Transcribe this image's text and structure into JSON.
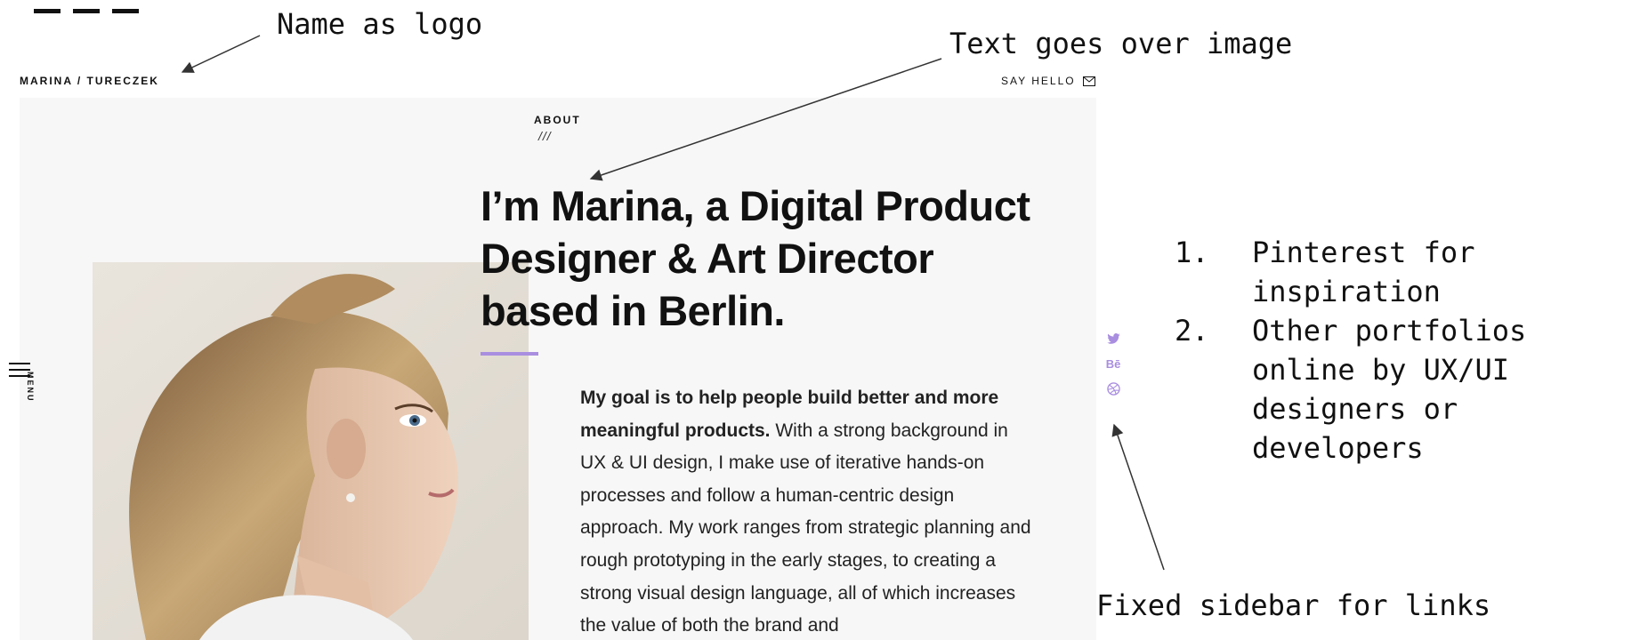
{
  "header": {
    "logo": "MARINA / TURECZEK",
    "say_hello": "SAY HELLO"
  },
  "section": {
    "label": "ABOUT",
    "divider": "///"
  },
  "headline": "I’m Marina, a Digital Product Designer & Art Director based in Berlin.",
  "body": {
    "lead": "My goal is to help people build better and more meaningful products.",
    "text": " With a strong background in UX & UI design, I make use of iterative hands-on processes and follow a human-centric design approach. My work ranges from strategic planning and rough prototyping in the early stages, to creating a strong visual design language, all of which increases the value of both the brand and"
  },
  "menu": {
    "label": "MENU"
  },
  "social": {
    "items": [
      {
        "icon": "twitter-icon"
      },
      {
        "icon": "behance-icon",
        "glyph": "Bē"
      },
      {
        "icon": "dribbble-icon"
      }
    ]
  },
  "annotations": {
    "logo_note": "Name as logo",
    "text_note": "Text goes over image",
    "sidebar_note": "Fixed sidebar for links",
    "list": [
      {
        "num": "1.",
        "text": "Pinterest for inspiration"
      },
      {
        "num": "2.",
        "text": "Other portfolios online by UX/UI designers or developers"
      }
    ]
  },
  "colors": {
    "accent": "#a98ee0",
    "panel_bg": "#f7f7f7",
    "text": "#111111"
  }
}
